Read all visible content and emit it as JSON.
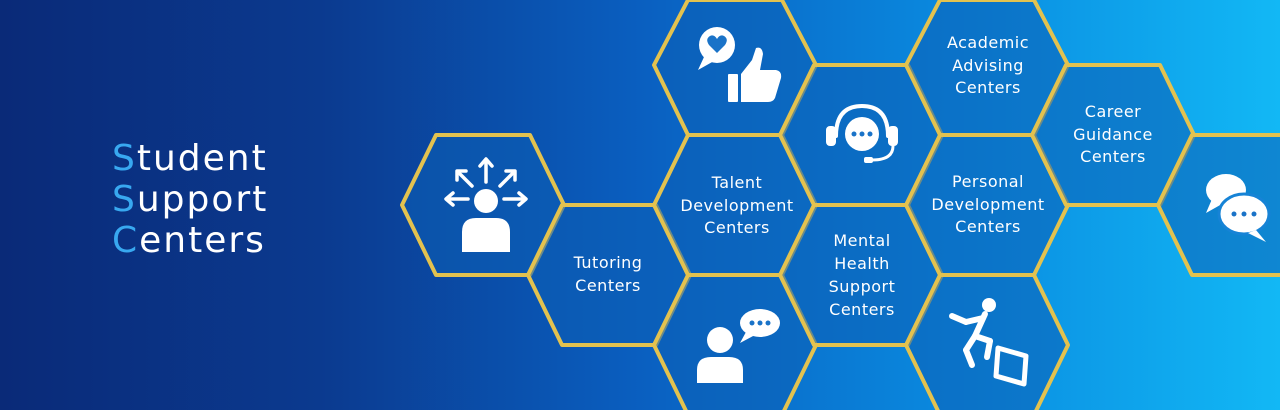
{
  "title": {
    "lines": [
      {
        "first": "S",
        "rest": "tudent"
      },
      {
        "first": "S",
        "rest": "upport"
      },
      {
        "first": "C",
        "rest": "enters"
      }
    ]
  },
  "hexagons": {
    "tutoring": [
      "Tutoring",
      "Centers"
    ],
    "talent": [
      "Talent",
      "Development",
      "Centers"
    ],
    "mental": [
      "Mental",
      "Health",
      "Support",
      "Centers"
    ],
    "academic": [
      "Academic",
      "Advising",
      "Centers"
    ],
    "personal": [
      "Personal",
      "Development",
      "Centers"
    ],
    "career": [
      "Career",
      "Guidance",
      "Centers"
    ]
  },
  "icons": {
    "guidance": "person-arrows-icon",
    "feedback": "heart-bubble-thumbs-up-icon",
    "support": "headset-chat-icon",
    "counseling": "person-chat-icon",
    "growth": "person-jumping-hurdle-icon",
    "chat": "chat-bubbles-icon"
  },
  "colors": {
    "accent_letter": "#38a8f0",
    "hex_border": "#e3c24f",
    "background_left": "#0a2a78",
    "background_right": "#12b8f5"
  }
}
